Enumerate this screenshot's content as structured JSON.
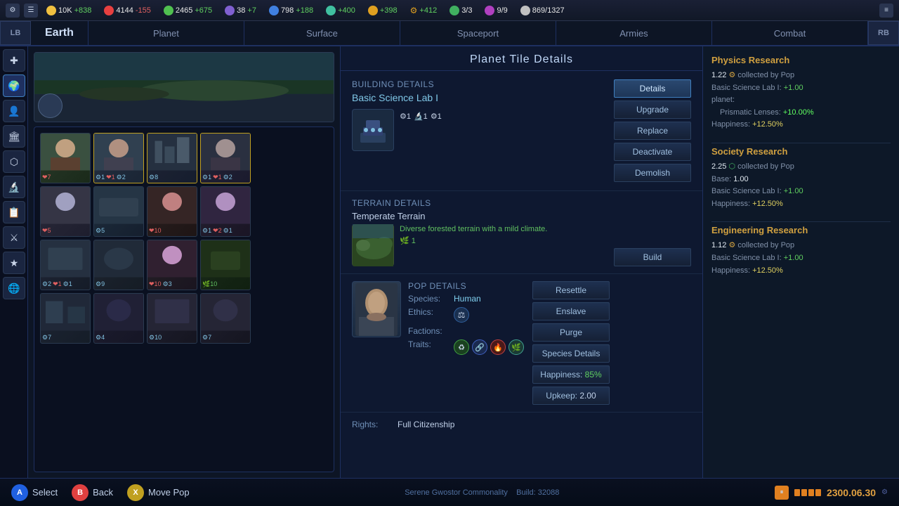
{
  "topbar": {
    "icons": [
      "⚙",
      "☰"
    ],
    "resources": [
      {
        "icon": "⚡",
        "color": "#f0c040",
        "value": "10K",
        "delta": "+838",
        "delta_color": "#60d060",
        "class": "res-energy"
      },
      {
        "icon": "💎",
        "color": "#e84040",
        "value": "4144",
        "delta": "-155",
        "delta_color": "#e06060",
        "class": "res-minerals"
      },
      {
        "icon": "🌿",
        "color": "#50c050",
        "value": "2465",
        "delta": "+675",
        "delta_color": "#60d060",
        "class": "res-food"
      },
      {
        "icon": "⬡",
        "color": "#8060d0",
        "value": "38",
        "delta": "+7",
        "delta_color": "#60d060",
        "class": "res-consumer"
      },
      {
        "icon": "⬡",
        "color": "#60a0d0",
        "value": "798",
        "delta": "+188",
        "delta_color": "#60d060",
        "class": "res-alloys"
      },
      {
        "icon": "⬡",
        "color": "#40c0a0",
        "value": "+400",
        "delta": "",
        "delta_color": "#60d060",
        "class": "res-trade"
      },
      {
        "icon": "⬡",
        "color": "#40c0a0",
        "value": "+398",
        "delta": "",
        "delta_color": "#60d060",
        "class": "res-unity"
      },
      {
        "icon": "⚙",
        "color": "#e0a020",
        "value": "+412",
        "delta": "",
        "delta_color": "#60d060",
        "class": "res-unity2"
      },
      {
        "icon": "♦",
        "color": "#40b060",
        "value": "3/3",
        "delta": "",
        "delta_color": "#60d060",
        "class": "res-amenity"
      },
      {
        "icon": "◆",
        "color": "#b040c0",
        "value": "9/9",
        "delta": "",
        "delta_color": "#60d060",
        "class": "res-influence"
      },
      {
        "icon": "▲",
        "color": "#4080e0",
        "value": "869",
        "delta": "/1327",
        "delta_color": "#8090a8",
        "class": "res-navy"
      }
    ]
  },
  "tabs": {
    "lb": "LB",
    "rb": "RB",
    "planet_name": "Earth",
    "items": [
      "Planet",
      "Surface",
      "Spaceport",
      "Armies",
      "Combat"
    ],
    "active": "Planet"
  },
  "panel_title": "Planet Tile Details",
  "building": {
    "section_title": "Building Details",
    "name": "Basic Science Lab I",
    "buttons": [
      "Details",
      "Upgrade",
      "Replace",
      "Deactivate",
      "Demolish"
    ]
  },
  "terrain": {
    "section_title": "Terrain Details",
    "name": "Temperate Terrain",
    "description": "Diverse forested terrain with a mild climate.",
    "resource_badge": "🌿 1",
    "build_button": "Build"
  },
  "pop": {
    "section_title": "Pop Details",
    "species_label": "Species:",
    "species_value": "Human",
    "ethics_label": "Ethics:",
    "factions_label": "Factions:",
    "traits_label": "Traits:",
    "buttons": [
      "Resettle",
      "Enslave",
      "Purge",
      "Species Details",
      "Happiness: 85%",
      "Upkeep: 2.00"
    ]
  },
  "rights": {
    "label": "Rights:",
    "value": "Full Citizenship"
  },
  "research": {
    "sections": [
      {
        "title": "Physics Research",
        "amount": "1.22",
        "source": "collected by Pop",
        "lines": [
          "Basic Science Lab I: +1.00",
          "planet:",
          "  Prismatic Lenses: +10.00%",
          "Happiness: +12.50%"
        ]
      },
      {
        "title": "Society Research",
        "amount": "2.25",
        "source": "collected by Pop",
        "lines": [
          "Base: 1.00",
          "Basic Science Lab I: +1.00",
          "Happiness: +12.50%"
        ]
      },
      {
        "title": "Engineering Research",
        "amount": "1.12",
        "source": "collected by Pop",
        "lines": [
          "Basic Science Lab I: +1.00",
          "Happiness: +12.50%"
        ]
      }
    ]
  },
  "bottom": {
    "select_label": "Select",
    "back_label": "Back",
    "move_pop_label": "Move Pop",
    "center_text": "Serene Gwostor Commonality",
    "build_info": "Build: 32088",
    "time": "2300.06.30"
  },
  "tiles": {
    "rows": [
      [
        {
          "icons": "❤7",
          "color": "#e06060"
        },
        {
          "icons": "⚙1 ❤1 ⚙2",
          "color": "#80c0e0"
        },
        {
          "icons": "⚙8",
          "color": "#80c0e0"
        },
        {
          "icons": "⚙1 ❤1 ⚙2",
          "color": "#80c0e0"
        }
      ],
      [
        {
          "icons": "❤5",
          "color": "#e06060"
        },
        {
          "icons": "⚙5",
          "color": "#80c0e0"
        },
        {
          "icons": "❤10",
          "color": "#e06060"
        },
        {
          "icons": "⚙1 ❤2 ⚙1",
          "color": "#80c0e0"
        }
      ],
      [
        {
          "icons": "⚙2 ❤1 ⚙1",
          "color": "#80c0e0"
        },
        {
          "icons": "⚙9",
          "color": "#80c0e0"
        },
        {
          "icons": "❤10 ⚙3",
          "color": "#e06060"
        },
        {
          "icons": "🌿10",
          "color": "#60c060"
        }
      ],
      [
        {
          "icons": "⚙7",
          "color": "#80c0e0"
        },
        {
          "icons": "⚙4",
          "color": "#80c0e0"
        },
        {
          "icons": "⚙10",
          "color": "#80c0e0"
        },
        {
          "icons": "⚙7",
          "color": "#80c0e0"
        }
      ]
    ]
  }
}
